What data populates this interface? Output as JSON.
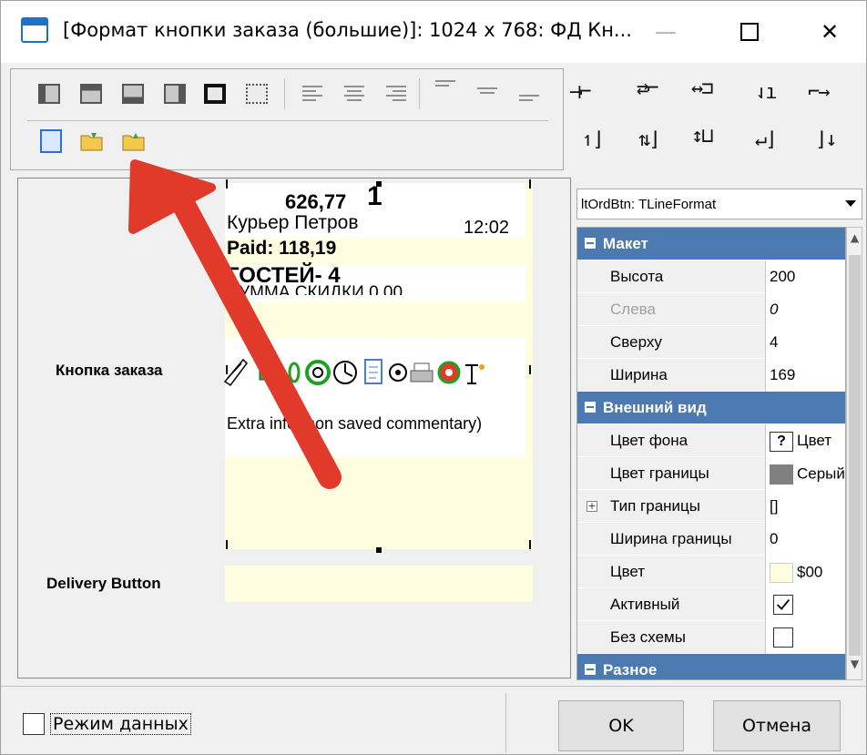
{
  "window": {
    "title": "[Формат кнопки заказа (большие)]: 1024 x 768: ФД Кн...",
    "minimize_glyph": "—",
    "close_glyph": "✕"
  },
  "preview": {
    "canvas_texts": {
      "amount": "626,77",
      "amount_mark": "1",
      "courier": "Курьер Петров",
      "time": "12:02",
      "paid": "Paid: 118,19",
      "guests": "ГОСТЕЙ- 4",
      "discount": "СУММА СКИДКИ 0,00",
      "extra": "Extra info (non saved commentary)"
    },
    "label_order": "Кнопка заказа",
    "label_delivery": "Delivery Button"
  },
  "inspector": {
    "component": "ltOrdBtn: TLineFormat",
    "rows": [
      {
        "type": "category",
        "name": "Макет"
      },
      {
        "type": "prop",
        "name": "Высота",
        "value": "200"
      },
      {
        "type": "prop",
        "name": "Слева",
        "value": "0",
        "dim": true
      },
      {
        "type": "prop",
        "name": "Сверху",
        "value": "4"
      },
      {
        "type": "prop",
        "name": "Ширина",
        "value": "169"
      },
      {
        "type": "category",
        "name": "Внешний вид"
      },
      {
        "type": "prop",
        "name": "Цвет фона",
        "value": "Цвет"
      },
      {
        "type": "prop",
        "name": "Цвет границы",
        "value": "Серый"
      },
      {
        "type": "prop",
        "name": "Тип границы",
        "value": "[]"
      },
      {
        "type": "prop",
        "name": "Ширина границы",
        "value": "0"
      },
      {
        "type": "prop",
        "name": "Цвет",
        "value": "$00"
      },
      {
        "type": "prop",
        "name": "Активный",
        "value": ""
      },
      {
        "type": "prop",
        "name": "Без схемы",
        "value": ""
      },
      {
        "type": "category",
        "name": "Разное"
      }
    ],
    "colors": {
      "category_bg": "#4b79b0",
      "swatch_gray": "#808080",
      "swatch_cream": "#fffde0"
    }
  },
  "footer": {
    "data_mode_label": "Режим данных",
    "ok_label": "OK",
    "cancel_label": "Отмена"
  }
}
